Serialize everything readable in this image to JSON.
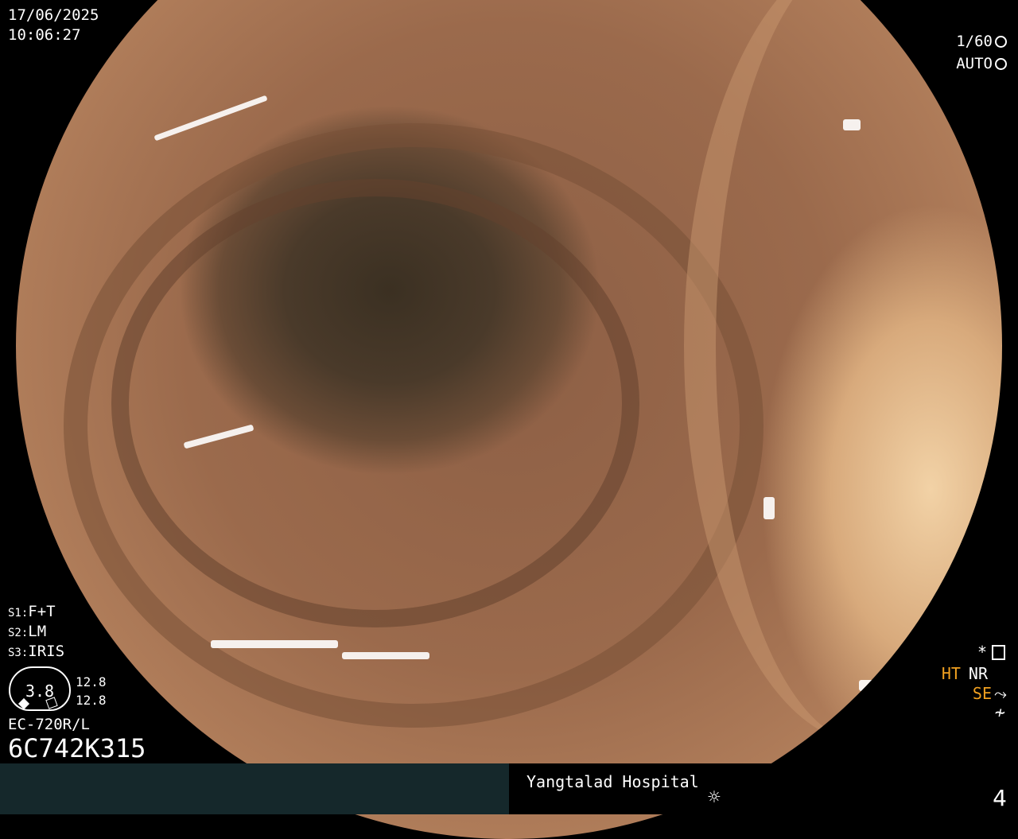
{
  "header": {
    "date": "17/06/2025",
    "time": "10:06:27",
    "shutter": "1/60",
    "shutter_icon": "aperture-icon",
    "iris": "AUTO",
    "iris_icon": "iris-icon"
  },
  "settings": {
    "s1_prefix": "S1:",
    "s1_value": "F+T",
    "s2_prefix": "S2:",
    "s2_value": "LM",
    "s3_prefix": "S3:",
    "s3_value": "IRIS"
  },
  "gauge": {
    "value": "3.8",
    "upper": "12.8",
    "lower": "12.8"
  },
  "scope": {
    "model": "EC-720R/L",
    "serial": "6C742K315"
  },
  "status": {
    "star": "*",
    "ht": "HT",
    "nr": "NR",
    "se": "SE",
    "se_icon": "curve-icon",
    "nf": "≁"
  },
  "footer": {
    "hospital": "Yangtalad Hospital",
    "light_icon": "sun-icon",
    "light_glyph": "☼",
    "counter": "4"
  }
}
